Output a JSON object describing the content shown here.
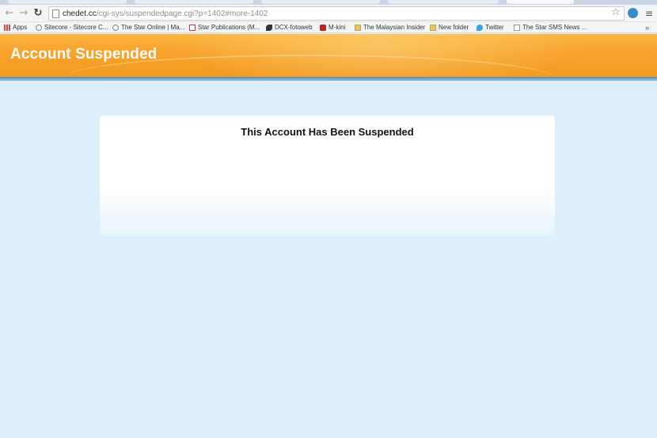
{
  "browser": {
    "url_host": "chedet.cc",
    "url_path": "/cgi-sys/suspendedpage.cgi?p=1402#more-1402",
    "bookmarks": [
      {
        "label": "Apps",
        "icon": "apps-grid-icon"
      },
      {
        "label": "Sitecore - Sitecore C...",
        "icon": "sitecore-icon"
      },
      {
        "label": "The Star Online | Ma...",
        "icon": "sitecore-icon"
      },
      {
        "label": "Star Publications (M...",
        "icon": "gmail-icon"
      },
      {
        "label": "DCX-fotoweb",
        "icon": "dcx-icon"
      },
      {
        "label": "M-kini",
        "icon": "mkini-icon"
      },
      {
        "label": "The Malaysian Insider",
        "icon": "folder-icon"
      },
      {
        "label": "New folder",
        "icon": "folder-icon"
      },
      {
        "label": "Twitter",
        "icon": "twitter-bird-icon"
      },
      {
        "label": "The Star SMS News ...",
        "icon": "document-icon"
      }
    ],
    "more": "»"
  },
  "banner": {
    "title": "Account Suspended"
  },
  "main": {
    "heading": "This Account Has Been Suspended"
  }
}
